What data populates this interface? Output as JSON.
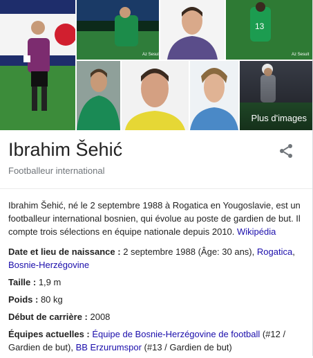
{
  "images": {
    "more_label": "Plus d'images",
    "tiles": [
      {
        "icon": "goalkeeper-full-body-photo"
      },
      {
        "icon": "match-celebration-photo"
      },
      {
        "icon": "portrait-photo-purple-kit"
      },
      {
        "icon": "goalkeeper-back-13-photo"
      },
      {
        "icon": "goalkeeper-green-kit-photo"
      },
      {
        "icon": "headshot-yellow-kit-photo"
      },
      {
        "icon": "headshot-blue-kit-photo"
      },
      {
        "icon": "goalkeeper-save-photo"
      }
    ]
  },
  "entity": {
    "name": "Ibrahim Šehić",
    "type": "Footballeur international"
  },
  "description": {
    "text": "Ibrahim Šehić, né le 2 septembre 1988 à Rogatica en Yougoslavie, est un footballeur international bosnien, qui évolue au poste de gardien de but. Il compte trois sélections en équipe nationale depuis 2010. ",
    "source_link": "Wikipédia"
  },
  "facts": {
    "birth": {
      "label": "Date et lieu de naissance :",
      "value": " 2 septembre 1988 (Âge: 30 ans), ",
      "link1": "Rogatica",
      "sep": ", ",
      "link2": "Bosnie-Herzégovine"
    },
    "height": {
      "label": "Taille :",
      "value": " 1,9 m"
    },
    "weight": {
      "label": "Poids :",
      "value": " 80 kg"
    },
    "debut": {
      "label": "Début de carrière :",
      "value": " 2008"
    },
    "teams": {
      "label": "Équipes actuelles :",
      "link1": "Équipe de Bosnie-Herzégovine de football",
      "text1": " (#12 / Gardien de but), ",
      "link2": "BB Erzurumspor",
      "text2": " (#13 / Gardien de but)"
    }
  },
  "colors": {
    "link": "#1a0dab",
    "muted": "#70757a"
  }
}
